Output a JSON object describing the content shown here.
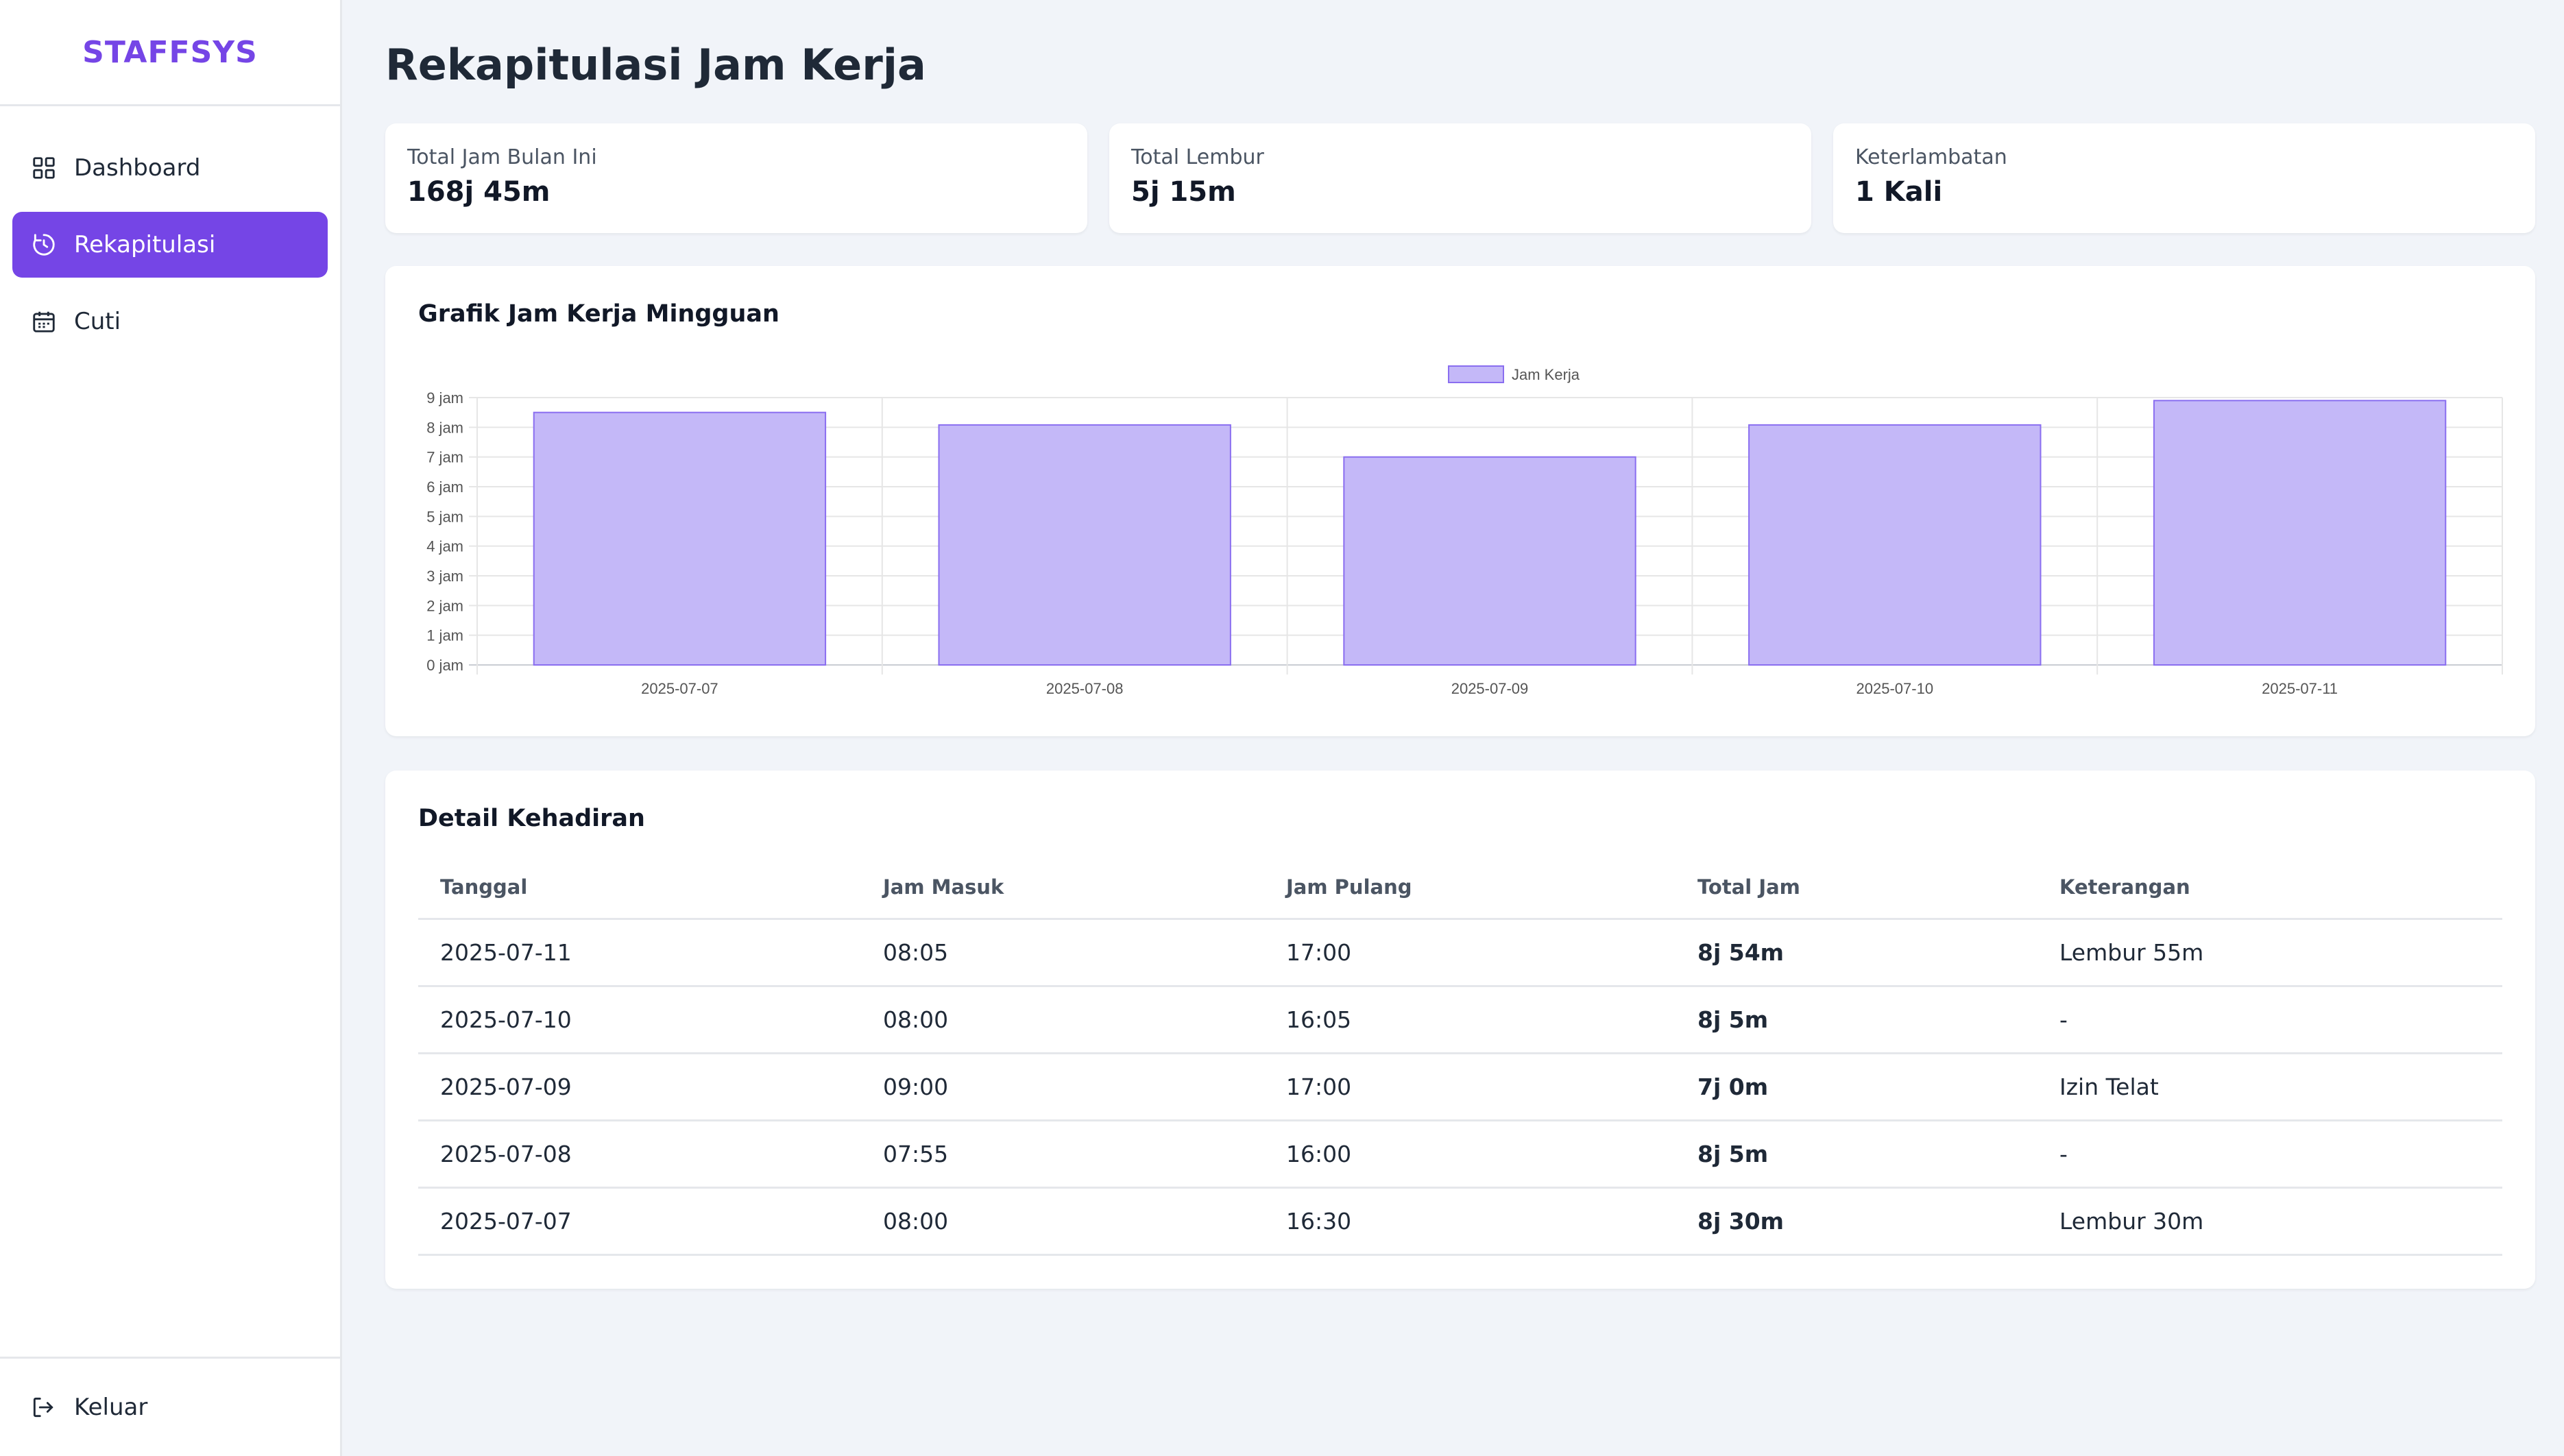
{
  "app": {
    "logo": "STAFFSYS"
  },
  "sidebar": {
    "items": [
      {
        "label": "Dashboard",
        "icon": "dashboard-grid-icon",
        "active": false
      },
      {
        "label": "Rekapitulasi",
        "icon": "clock-history-icon",
        "active": true
      },
      {
        "label": "Cuti",
        "icon": "calendar-icon",
        "active": false
      }
    ],
    "logout_label": "Keluar",
    "logout_icon": "logout-icon"
  },
  "page": {
    "title": "Rekapitulasi Jam Kerja"
  },
  "stats": [
    {
      "label": "Total Jam Bulan Ini",
      "value": "168j 45m"
    },
    {
      "label": "Total Lembur",
      "value": "5j 15m"
    },
    {
      "label": "Keterlambatan",
      "value": "1 Kali"
    }
  ],
  "chart": {
    "section_title": "Grafik Jam Kerja Mingguan"
  },
  "chart_data": {
    "type": "bar",
    "title": "Grafik Jam Kerja Mingguan",
    "categories": [
      "2025-07-07",
      "2025-07-08",
      "2025-07-09",
      "2025-07-10",
      "2025-07-11"
    ],
    "series": [
      {
        "name": "Jam Kerja",
        "values": [
          8.5,
          8.08,
          7.0,
          8.08,
          8.9
        ]
      }
    ],
    "y_ticks": [
      "0 jam",
      "1 jam",
      "2 jam",
      "3 jam",
      "4 jam",
      "5 jam",
      "6 jam",
      "7 jam",
      "8 jam",
      "9 jam"
    ],
    "ylim": [
      0,
      9
    ],
    "grid": true,
    "legend": "top-center",
    "bar_color": "#c4b8f8",
    "bar_border": "#8a6ef0"
  },
  "table": {
    "section_title": "Detail Kehadiran",
    "headers": [
      "Tanggal",
      "Jam Masuk",
      "Jam Pulang",
      "Total Jam",
      "Keterangan"
    ],
    "rows": [
      [
        "2025-07-11",
        "08:05",
        "17:00",
        "8j 54m",
        "Lembur 55m"
      ],
      [
        "2025-07-10",
        "08:00",
        "16:05",
        "8j 5m",
        "-"
      ],
      [
        "2025-07-09",
        "09:00",
        "17:00",
        "7j 0m",
        "Izin Telat"
      ],
      [
        "2025-07-08",
        "07:55",
        "16:00",
        "8j 5m",
        "-"
      ],
      [
        "2025-07-07",
        "08:00",
        "16:30",
        "8j 30m",
        "Lembur 30m"
      ]
    ]
  },
  "colors": {
    "accent": "#7545e6",
    "background": "#f1f4f9"
  }
}
